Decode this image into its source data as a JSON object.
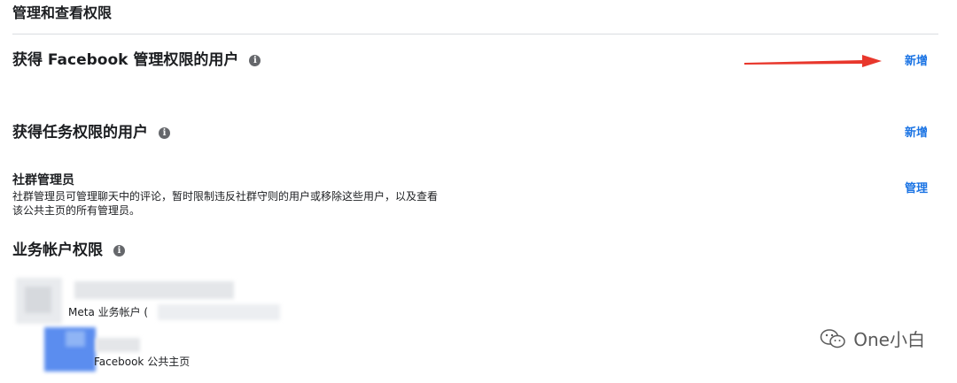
{
  "header": {
    "title": "管理和查看权限"
  },
  "sections": {
    "facebook_admins": {
      "title": "获得 Facebook 管理权限的用户",
      "info_icon": "info-icon",
      "add_label": "新增"
    },
    "task_users": {
      "title": "获得任务权限的用户",
      "info_icon": "info-icon",
      "add_label": "新增"
    },
    "community_manager": {
      "title": "社群管理员",
      "desc_line1": "社群管理员可管理聊天中的评论，暂时限制违反社群守则的用户或移除这些用户，以及查看",
      "desc_line2": "该公共主页的所有管理员。",
      "manage_label": "管理"
    },
    "business_access": {
      "title": "业务帐户权限",
      "info_icon": "info-icon"
    }
  },
  "assets": [
    {
      "label": "Meta 业务帐户 ("
    },
    {
      "label": "Facebook 公共主页"
    }
  ],
  "annotation": {
    "arrow_color": "#e8372c"
  },
  "watermark": {
    "text": "One小白",
    "icon": "wechat-icon"
  },
  "colors": {
    "link": "#1b74e4",
    "divider": "#dadde1"
  }
}
